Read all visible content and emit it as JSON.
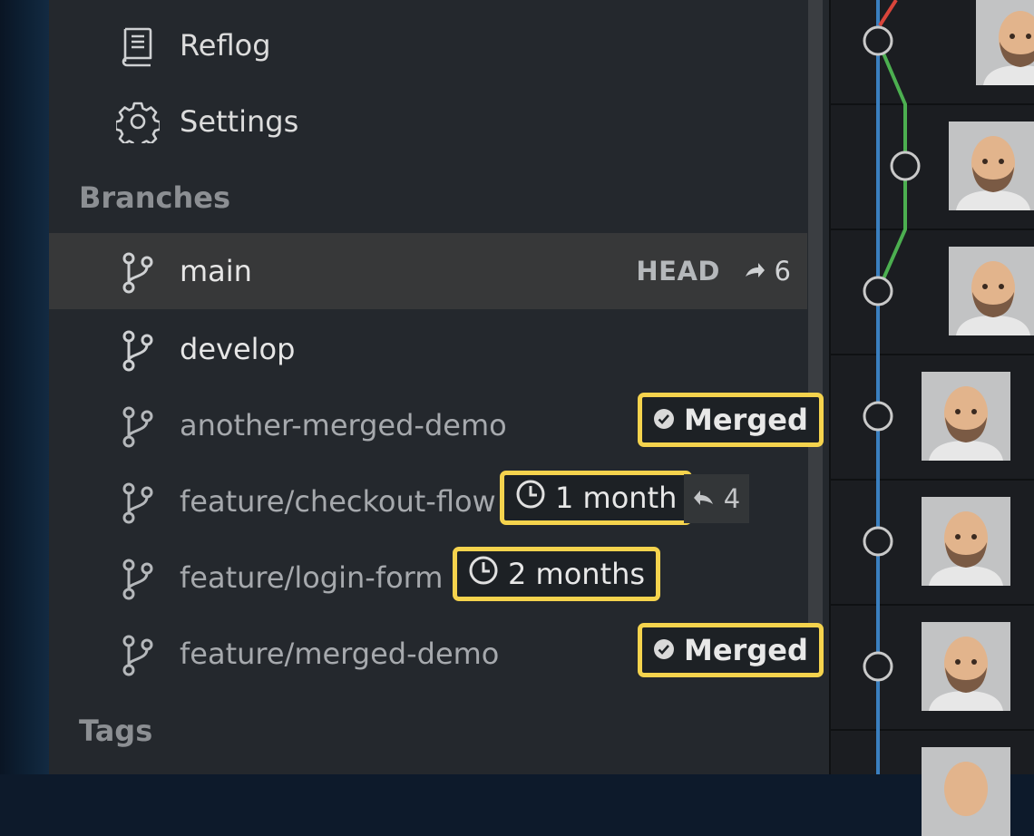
{
  "nav": {
    "reflog_label": "Reflog",
    "settings_label": "Settings"
  },
  "sections": {
    "branches_title": "Branches",
    "tags_title": "Tags"
  },
  "branches": [
    {
      "name": "main",
      "head_label": "HEAD",
      "ahead_count": "6",
      "current": true
    },
    {
      "name": "develop"
    },
    {
      "name": "another-merged-demo",
      "badge": "Merged"
    },
    {
      "name": "feature/checkout-flow",
      "age": "1 month",
      "behind_count": "4"
    },
    {
      "name": "feature/login-form",
      "age": "2 months"
    },
    {
      "name": "feature/merged-demo",
      "badge": "Merged"
    }
  ],
  "colors": {
    "highlight_border": "#f5d34d",
    "main_lane": "#3a7fbf",
    "branch_lane": "#4caf50",
    "other_lane": "#d9453b"
  },
  "icons": {
    "reflog": "book-icon",
    "settings": "gear-icon",
    "branch": "git-branch-icon",
    "merged": "check-circle-icon",
    "age": "clock-icon",
    "ahead": "arrow-up-right-icon",
    "behind": "arrow-down-left-icon"
  }
}
